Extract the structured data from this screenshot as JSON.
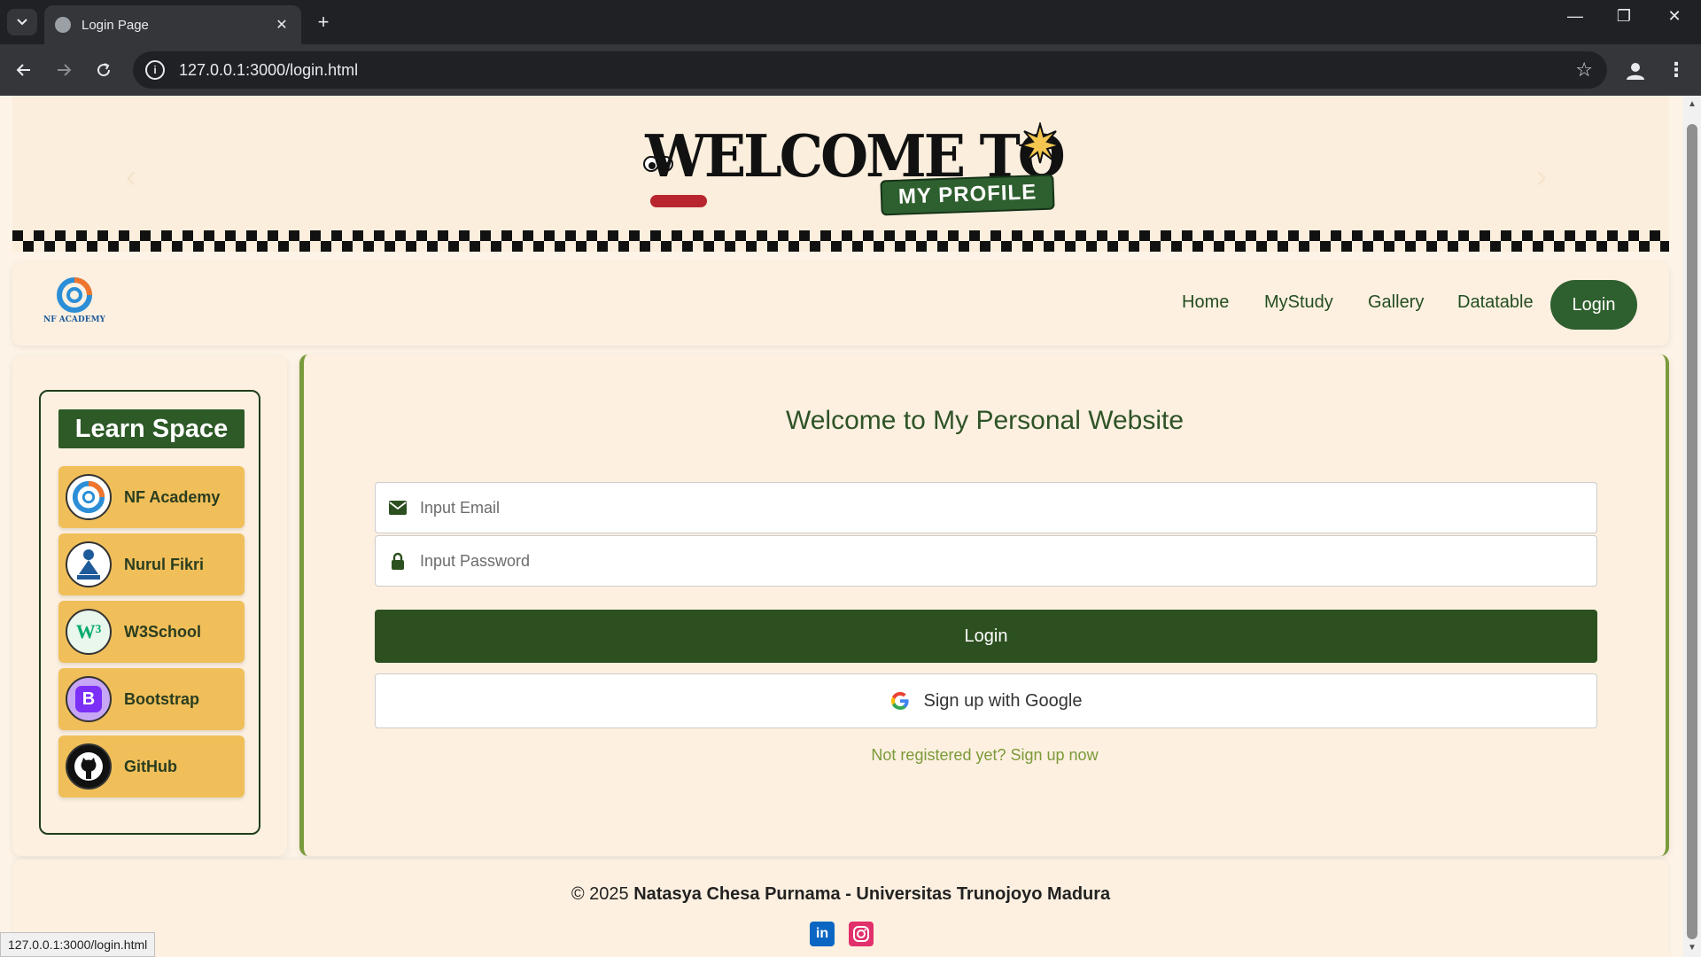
{
  "browser": {
    "tab_title": "Login Page",
    "url": "127.0.0.1:3000/login.html",
    "status_url": "127.0.0.1:3000/login.html"
  },
  "banner": {
    "title": "WELCOME TO",
    "subtitle": "MY PROFILE"
  },
  "navbar": {
    "brand": "NF ACADEMY",
    "links": [
      "Home",
      "MyStudy",
      "Gallery",
      "Datatable"
    ],
    "login_label": "Login"
  },
  "sidebar": {
    "title": "Learn Space",
    "items": [
      {
        "label": "NF Academy",
        "icon": "nf-academy-logo-icon"
      },
      {
        "label": "Nurul Fikri",
        "icon": "nurul-fikri-logo-icon"
      },
      {
        "label": "W3School",
        "icon": "w3schools-logo-icon"
      },
      {
        "label": "Bootstrap",
        "icon": "bootstrap-logo-icon"
      },
      {
        "label": "GitHub",
        "icon": "github-logo-icon"
      }
    ]
  },
  "login_form": {
    "heading": "Welcome to My Personal Website",
    "email_placeholder": "Input Email",
    "email_value": "",
    "password_placeholder": "Input Password",
    "password_value": "",
    "submit_label": "Login",
    "google_label": "Sign up with Google",
    "signup_text": "Not registered yet? Sign up now"
  },
  "footer": {
    "copyright": "© 2025",
    "author": "Natasya Chesa Purnama - Universitas Trunojoyo Madura",
    "social": [
      "linkedin-icon",
      "instagram-icon"
    ]
  },
  "colors": {
    "primary_green": "#2c5020",
    "accent_olive": "#7b9a3a",
    "sidebar_item": "#f0bf5a",
    "page_bg": "#fdf3e6"
  }
}
